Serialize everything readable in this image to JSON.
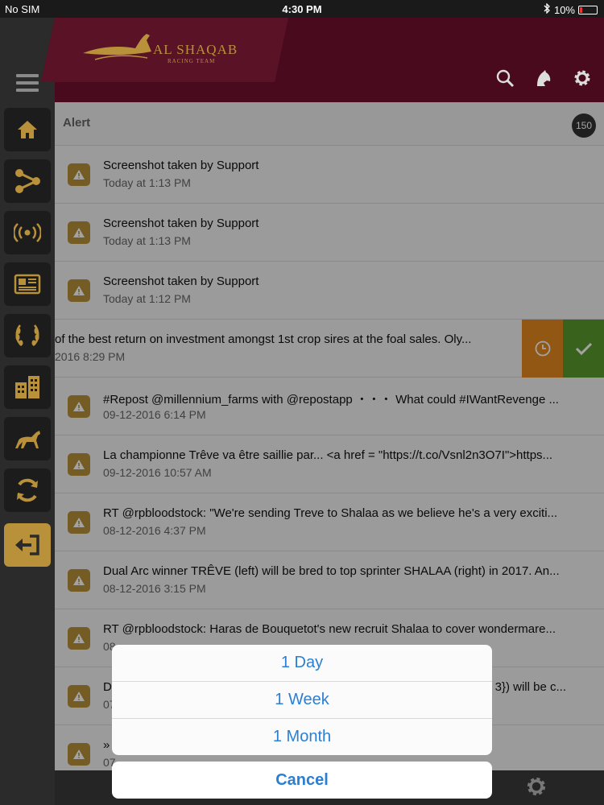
{
  "status_bar": {
    "carrier": "No SIM",
    "time": "4:30 PM",
    "battery": "10%"
  },
  "header": {
    "logo_title": "AL SHAQAB",
    "logo_subtitle": "RACING TEAM"
  },
  "alerts": {
    "title": "Alert",
    "count": "150",
    "items": [
      {
        "title": "Screenshot taken by Support",
        "time": "Today at 1:13 PM"
      },
      {
        "title": "Screenshot taken by Support",
        "time": "Today at 1:13 PM"
      },
      {
        "title": "Screenshot taken by Support",
        "time": "Today at 1:12 PM"
      },
      {
        "title": "of the best return on investment amongst 1st crop sires at the foal sales. Oly...",
        "time": "2016 8:29 PM"
      },
      {
        "title": "#Repost @millennium_farms with @repostapp ・・・ What could #IWantRevenge ...",
        "time": "09-12-2016 6:14 PM"
      },
      {
        "title": "La championne Trêve va être saillie par... <a href = \"https://t.co/Vsnl2n3O7I\">https...",
        "time": "09-12-2016 10:57 AM"
      },
      {
        "title": "RT @rpbloodstock: \"We're sending Treve to Shalaa as we believe he's a very exciti...",
        "time": "08-12-2016 4:37 PM"
      },
      {
        "title": "Dual Arc winner TRÊVE (left) will be bred to top sprinter SHALAA (right) in 2017. An...",
        "time": "08-12-2016 3:15 PM"
      },
      {
        "title": "RT @rpbloodstock: Haras de Bouquetot's new recruit Shalaa to cover wondermare...",
        "time": "08"
      },
      {
        "title": "D",
        "title_end": "3}) will be c...",
        "time": "07"
      },
      {
        "title": "»",
        "time": "07"
      }
    ]
  },
  "action_sheet": {
    "options": [
      "1 Day",
      "1 Week",
      "1 Month"
    ],
    "cancel": "Cancel"
  },
  "icons": {
    "sidebar": [
      "menu-icon",
      "home-icon",
      "share-icon",
      "broadcast-icon",
      "news-icon",
      "laurel-icon",
      "buildings-icon",
      "horse-icon",
      "sync-icon",
      "logout-icon"
    ],
    "header": [
      "search-icon",
      "horse-head-icon",
      "gear-icon"
    ]
  },
  "colors": {
    "brand_gold": "#b8913a",
    "header_maroon": "#4a0a1e",
    "swipe_orange": "#e48a1e",
    "swipe_green": "#5a9b2e",
    "link_blue": "#2a7fd4"
  }
}
